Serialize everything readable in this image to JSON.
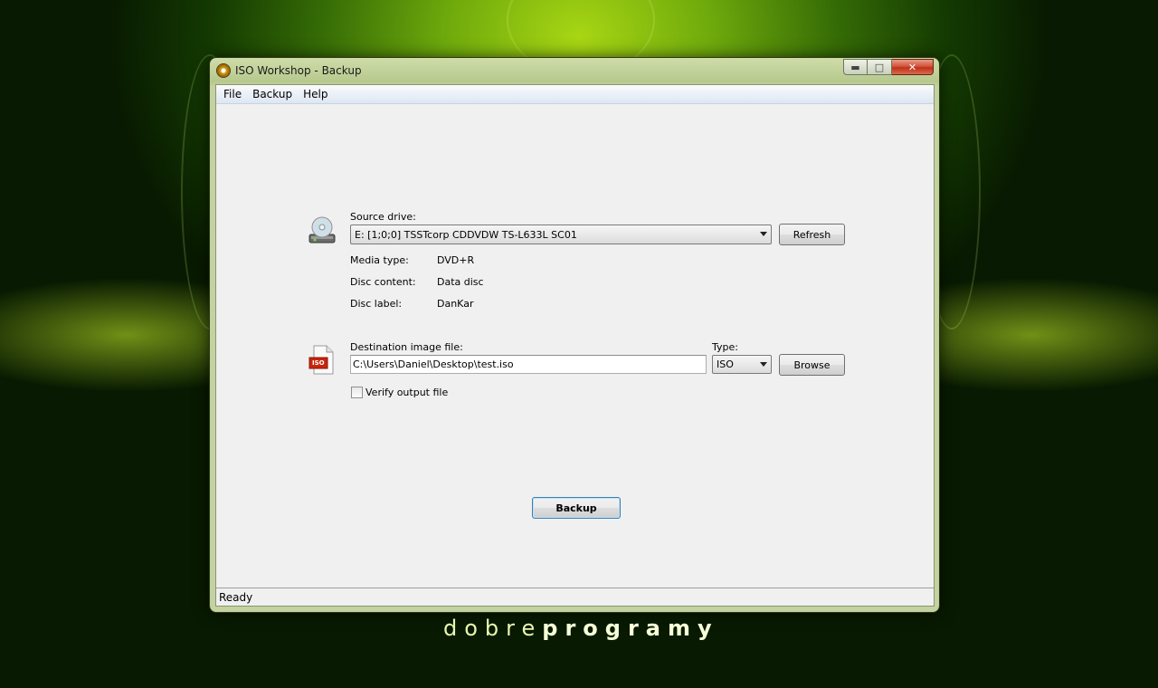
{
  "window": {
    "title": "ISO Workshop - Backup",
    "controls": {
      "minimize": "▬",
      "maximize": "□",
      "close": "✕"
    }
  },
  "menu": [
    "File",
    "Backup",
    "Help"
  ],
  "source": {
    "label": "Source drive:",
    "drive": "E:  [1;0;0] TSSTcorp CDDVDW TS-L633L  SC01",
    "refresh_label": "Refresh",
    "info": [
      {
        "label": "Media type:",
        "value": "DVD+R"
      },
      {
        "label": "Disc content:",
        "value": "Data disc"
      },
      {
        "label": "Disc label:",
        "value": "DanKar"
      }
    ]
  },
  "destination": {
    "label": "Destination image file:",
    "path": "C:\\Users\\Daniel\\Desktop\\test.iso",
    "type_label": "Type:",
    "type_value": "ISO",
    "browse_label": "Browse",
    "verify_label": "Verify output file",
    "verify_checked": false,
    "iso_icon_text": "ISO"
  },
  "backup_button": "Backup",
  "status": "Ready",
  "branding": {
    "part1": "dobre",
    "part2": "programy"
  },
  "icons": {
    "source": "cd-drive-icon",
    "destination": "iso-file-icon"
  }
}
